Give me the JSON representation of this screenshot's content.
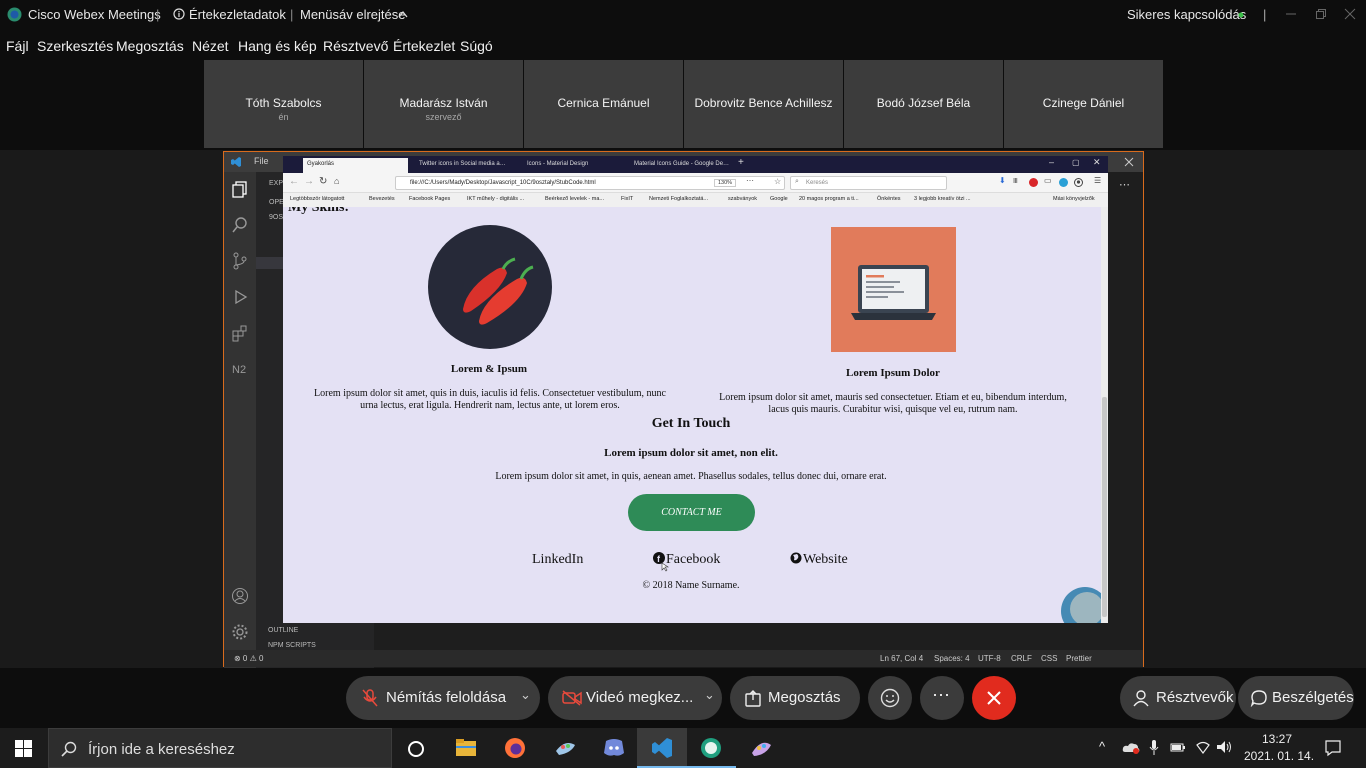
{
  "titlebar": {
    "app": "Cisco Webex Meetings",
    "meeting_info": "Értekezletadatok",
    "hide_menu": "Menüsáv elrejtése",
    "connection": "Sikeres kapcsolódás"
  },
  "menubar": [
    "Fájl",
    "Szerkesztés",
    "Megosztás",
    "Nézet",
    "Hang és kép",
    "Résztvevő",
    "Értekezlet",
    "Súgó"
  ],
  "participants": [
    {
      "name": "Tóth Szabolcs",
      "sub": "én"
    },
    {
      "name": "Madarász István",
      "sub": "szervező"
    },
    {
      "name": "Cernica Emánuel",
      "sub": ""
    },
    {
      "name": "Dobrovitz Bence Achillesz",
      "sub": ""
    },
    {
      "name": "Bodó József Béla",
      "sub": ""
    },
    {
      "name": "Czinege Dániel",
      "sub": ""
    }
  ],
  "vscode": {
    "menu_file": "File",
    "explorer_short": "EXP",
    "open_editors": "OPE",
    "folder": "9OS",
    "outline": "OUTLINE",
    "npm_scripts": "NPM SCRIPTS",
    "status": {
      "problems": "⊗ 0 ⚠ 0",
      "position": "Ln 67, Col 4",
      "spaces": "Spaces: 4",
      "encoding": "UTF-8",
      "eol": "CRLF",
      "language": "CSS",
      "formatter": "Prettier"
    }
  },
  "firefox": {
    "tabs": [
      "Gyakorlás",
      "Twitter icons in Social media a…",
      "Icons - Material Design",
      "Material Icons Guide - Google De…"
    ],
    "url": "file:///C:/Users/Mady/Desktop/Javascript_10C/9osztaly/StubCode.html",
    "zoom": "130%",
    "search_placeholder": "Keresés",
    "bookmarks": [
      "Legtöbbször látogatott",
      "Bevezetés",
      "Facebook Pages",
      "IKT műhely - digitális ...",
      "Beérkező levelek - ma...",
      "FixIT",
      "Nemzeti Foglalkoztatá...",
      "szabványok",
      "Google",
      "20 magos program a ti...",
      "Önkéntes",
      "3 legjobb kreatív ötzi ...",
      "Mási könyvjelzők"
    ]
  },
  "webpage": {
    "partial_heading": "My Skills:",
    "skill1_title": "Lorem & Ipsum",
    "skill1_text": "Lorem ipsum dolor sit amet, quis in duis, iaculis id felis. Consectetuer vestibulum, nunc urna lectus, erat ligula. Hendrerit nam, lectus ante, ut lorem eros.",
    "skill2_title": "Lorem Ipsum Dolor",
    "skill2_text": "Lorem ipsum dolor sit amet, mauris sed consectetuer. Etiam et eu, bibendum interdum, lacus quis mauris. Curabitur wisi, quisque vel eu, rutrum nam.",
    "contact_heading": "Get In Touch",
    "contact_sub": "Lorem ipsum dolor sit amet, non elit.",
    "contact_text": "Lorem ipsum dolor sit amet, in quis, aenean amet. Phasellus sodales, tellus donec dui, ornare erat.",
    "contact_button": "CONTACT ME",
    "link_linkedin": "LinkedIn",
    "link_facebook": "Facebook",
    "link_website": "Website",
    "footer": "© 2018 Name Surname."
  },
  "controls": {
    "mute": "Némítás feloldása",
    "video": "Videó megkez...",
    "share": "Megosztás",
    "participants": "Résztvevők",
    "chat": "Beszélgetés"
  },
  "taskbar": {
    "search": "Írjon ide a kereséshez",
    "time": "13:27",
    "date": "2021. 01. 14."
  },
  "colors": {
    "accent_green": "#2e8b57",
    "leave_red": "#e12b1e",
    "vscode_orange": "#d86b1d",
    "page_bg": "#e4e1f4"
  }
}
